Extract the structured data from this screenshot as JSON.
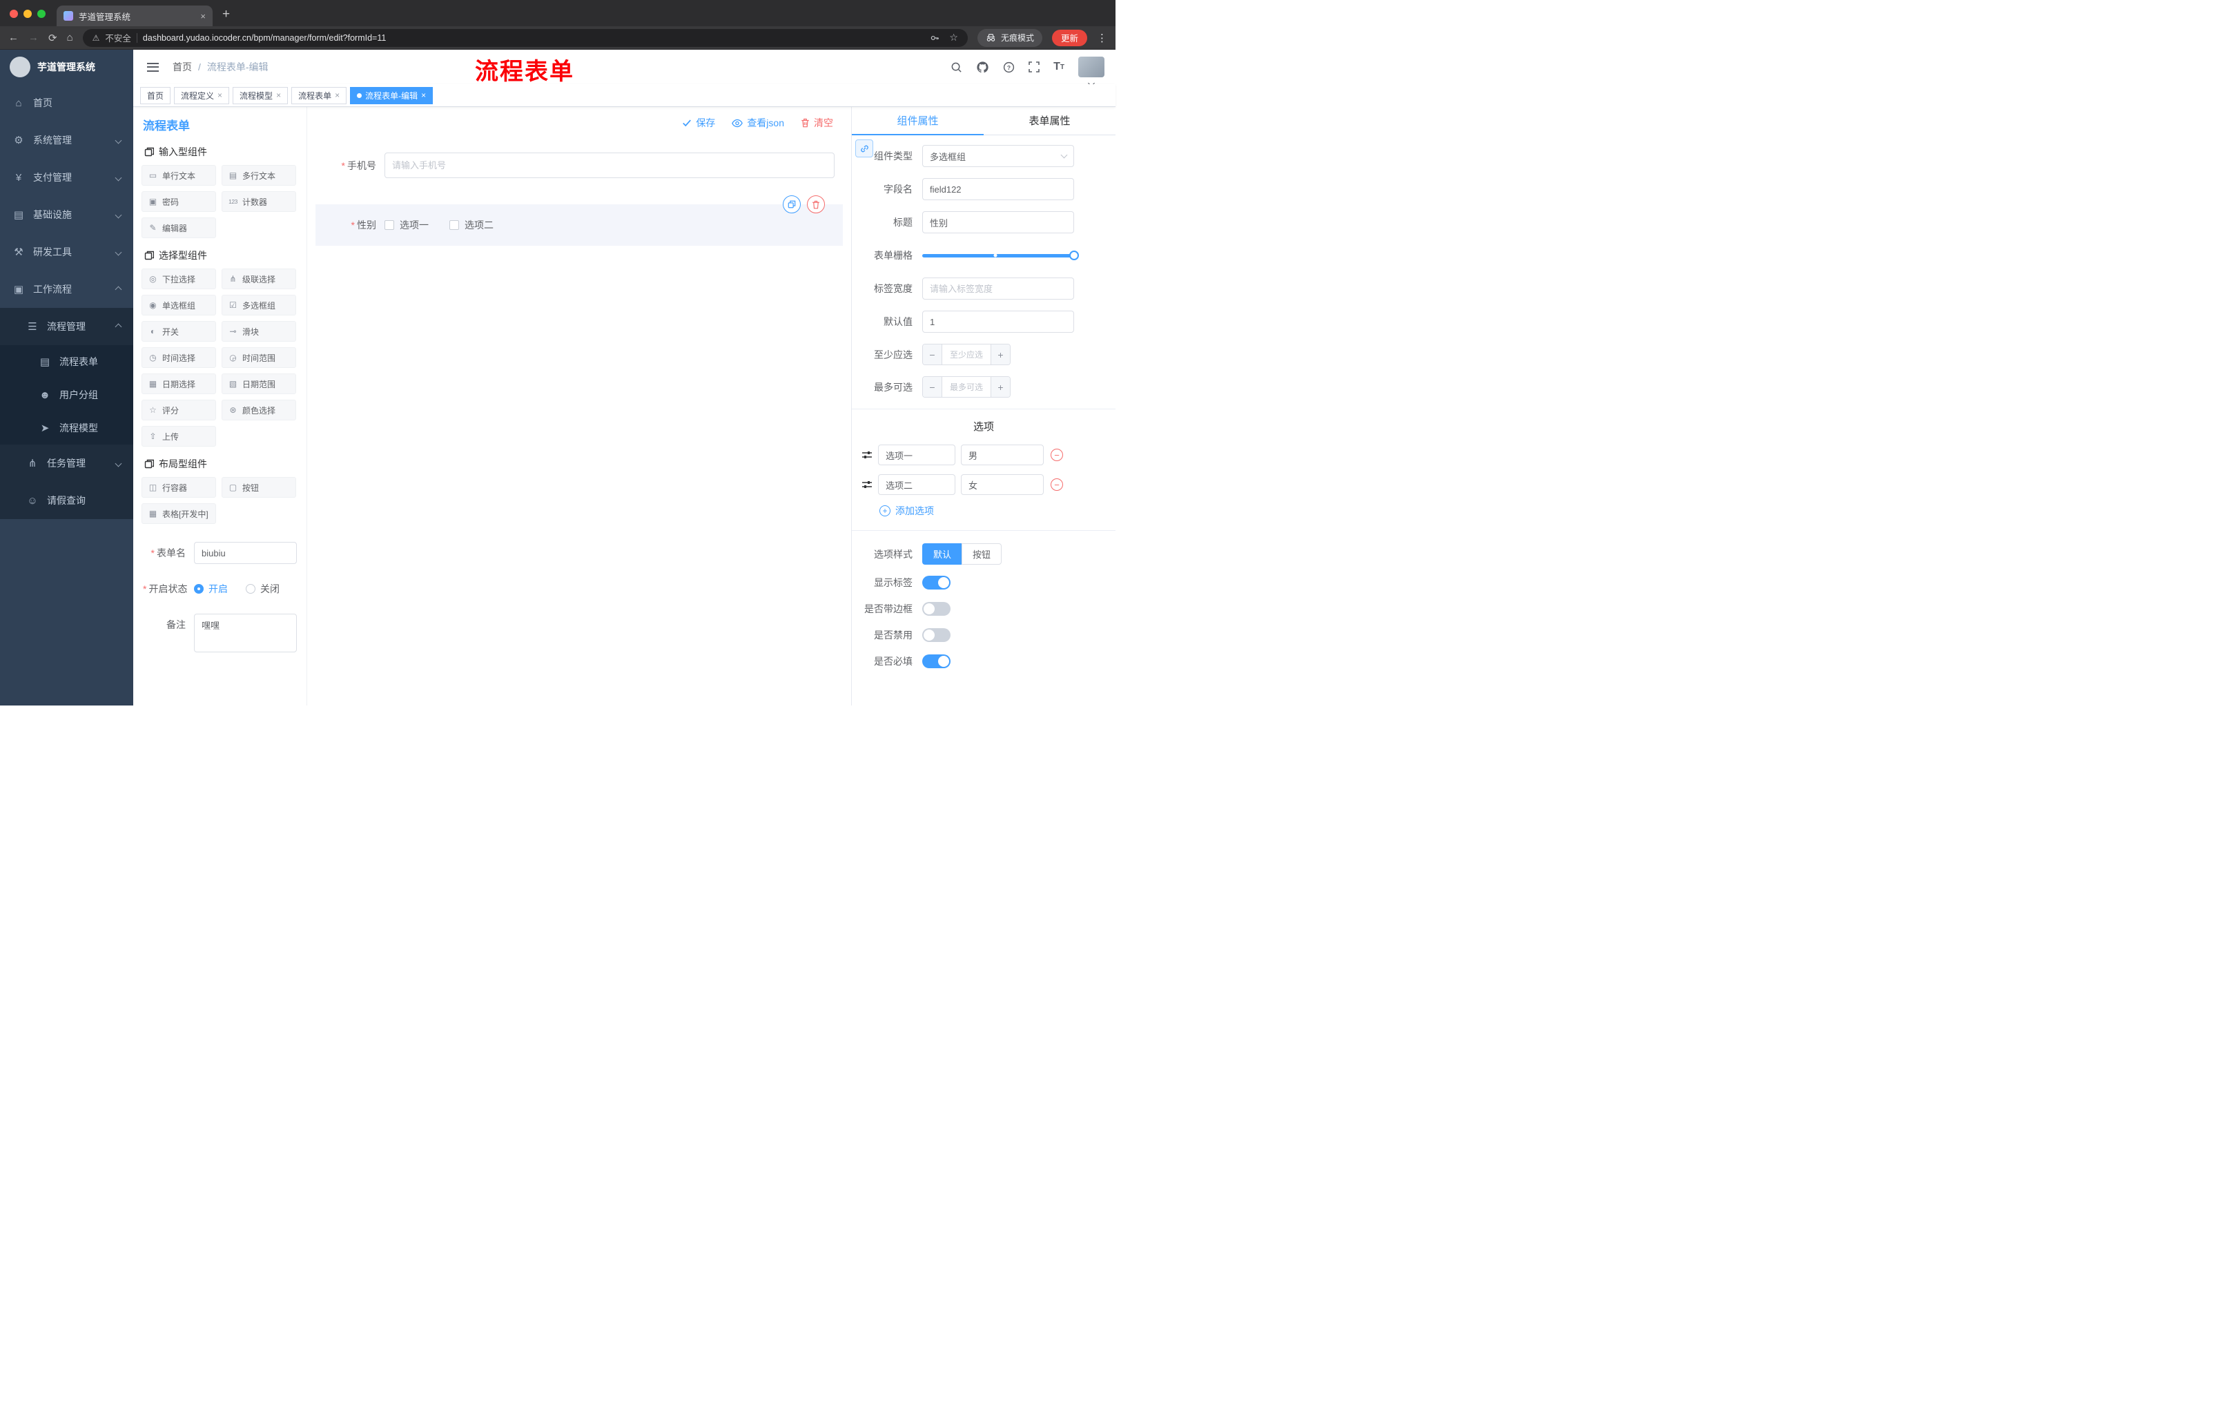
{
  "glyphs": {
    "required": "*",
    "close": "×",
    "slash": "/",
    "minus": "−",
    "plus": "+",
    "dots": "⋮",
    "warning": "⚠",
    "star": "☆",
    "back": "←",
    "forward": "→",
    "reload": "⟳",
    "home": "⌂",
    "newtab": "+"
  },
  "colors": {
    "accent": "#409eff",
    "danger": "#f56c6c",
    "annotation": "#fb0007",
    "sidebar_bg": "#304156",
    "sidebar_sub_bg": "#1f2d3d"
  },
  "browser": {
    "tab_title": "芋道管理系统",
    "security_label": "不安全",
    "url": "dashboard.yudao.iocoder.cn/bpm/manager/form/edit?formId=11",
    "incognito_label": "无痕模式",
    "update_label": "更新"
  },
  "sidebar": {
    "logo_title": "芋道管理系统",
    "items": [
      {
        "icon": "⌂",
        "label": "首页"
      },
      {
        "icon": "⚙",
        "label": "系统管理"
      },
      {
        "icon": "¥",
        "label": "支付管理"
      },
      {
        "icon": "▤",
        "label": "基础设施"
      },
      {
        "icon": "⚒",
        "label": "研发工具"
      },
      {
        "icon": "▣",
        "label": "工作流程"
      },
      {
        "icon": "☰",
        "label": "流程管理"
      },
      {
        "icon": "▤",
        "label": "流程表单"
      },
      {
        "icon": "☻",
        "label": "用户分组"
      },
      {
        "icon": "➤",
        "label": "流程模型"
      },
      {
        "icon": "⋔",
        "label": "任务管理"
      },
      {
        "icon": "☺",
        "label": "请假查询"
      }
    ]
  },
  "header": {
    "breadcrumb_home": "首页",
    "breadcrumb_current": "流程表单-编辑",
    "annotation": "流程表单"
  },
  "tags": [
    {
      "label": "首页"
    },
    {
      "label": "流程定义"
    },
    {
      "label": "流程模型"
    },
    {
      "label": "流程表单"
    },
    {
      "label": "流程表单-编辑"
    }
  ],
  "palette": {
    "title": "流程表单",
    "sections": [
      {
        "title": "输入型组件",
        "items": [
          {
            "icon": "▭",
            "label": "单行文本"
          },
          {
            "icon": "▤",
            "label": "多行文本"
          },
          {
            "icon": "▣",
            "label": "密码"
          },
          {
            "icon": "123",
            "label": "计数器"
          },
          {
            "icon": "✎",
            "label": "编辑器"
          }
        ]
      },
      {
        "title": "选择型组件",
        "items": [
          {
            "icon": "◎",
            "label": "下拉选择"
          },
          {
            "icon": "⋔",
            "label": "级联选择"
          },
          {
            "icon": "◉",
            "label": "单选框组"
          },
          {
            "icon": "☑",
            "label": "多选框组"
          },
          {
            "icon": "◐",
            "label": "开关"
          },
          {
            "icon": "⊸",
            "label": "滑块"
          },
          {
            "icon": "◷",
            "label": "时间选择"
          },
          {
            "icon": "◶",
            "label": "时间范围"
          },
          {
            "icon": "▦",
            "label": "日期选择"
          },
          {
            "icon": "▧",
            "label": "日期范围"
          },
          {
            "icon": "☆",
            "label": "评分"
          },
          {
            "icon": "⊛",
            "label": "颜色选择"
          },
          {
            "icon": "⇧",
            "label": "上传"
          }
        ]
      },
      {
        "title": "布局型组件",
        "items": [
          {
            "icon": "◫",
            "label": "行容器"
          },
          {
            "icon": "▢",
            "label": "按钮"
          },
          {
            "icon": "▦",
            "label": "表格[开发中]"
          }
        ]
      }
    ],
    "form": {
      "name_label": "表单名",
      "name_value": "biubiu",
      "status_label": "开启状态",
      "status_on": "开启",
      "status_off": "关闭",
      "remark_label": "备注",
      "remark_value": "嘿嘿"
    }
  },
  "canvas": {
    "toolbar": {
      "save": "保存",
      "view_json": "查看json",
      "clear": "清空"
    },
    "phone": {
      "label": "手机号",
      "placeholder": "请输入手机号"
    },
    "gender": {
      "label": "性别",
      "options": [
        "选项一",
        "选项二"
      ]
    }
  },
  "props": {
    "tabs": {
      "component": "组件属性",
      "form": "表单属性"
    },
    "component_type": {
      "label": "组件类型",
      "value": "多选框组"
    },
    "field_name": {
      "label": "字段名",
      "value": "field122"
    },
    "title": {
      "label": "标题",
      "value": "性别"
    },
    "grid": {
      "label": "表单栅格"
    },
    "label_width": {
      "label": "标签宽度",
      "placeholder": "请输入标签宽度"
    },
    "default_value": {
      "label": "默认值",
      "value": "1"
    },
    "min_select": {
      "label": "至少应选",
      "placeholder": "至少应选"
    },
    "max_select": {
      "label": "最多可选",
      "placeholder": "最多可选"
    },
    "options": {
      "heading": "选项",
      "rows": [
        {
          "label": "选项一",
          "value": "男"
        },
        {
          "label": "选项二",
          "value": "女"
        }
      ],
      "add": "添加选项"
    },
    "option_style": {
      "label": "选项样式",
      "default": "默认",
      "button": "按钮"
    },
    "toggles": [
      {
        "label": "显示标签",
        "on": true
      },
      {
        "label": "是否带边框",
        "on": false
      },
      {
        "label": "是否禁用",
        "on": false
      },
      {
        "label": "是否必填",
        "on": true
      }
    ]
  }
}
